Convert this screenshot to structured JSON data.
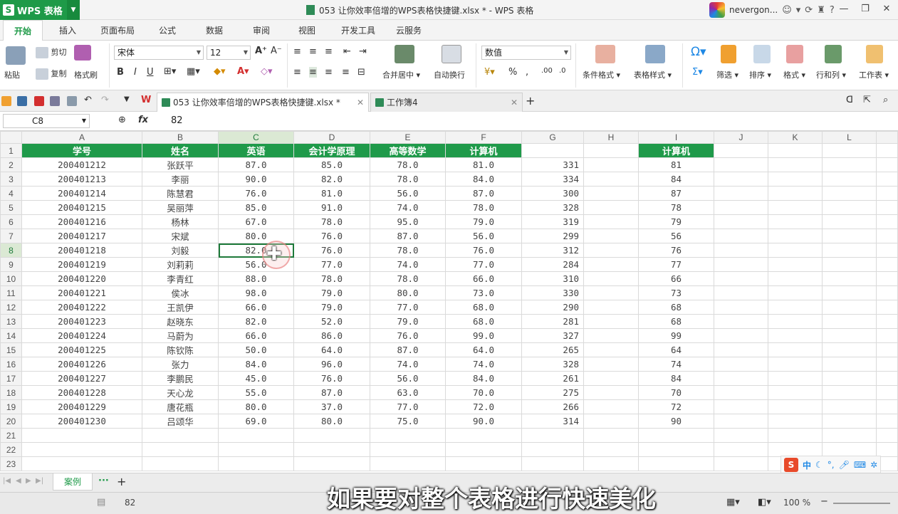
{
  "app": {
    "name": "WPS 表格",
    "doc_title": "053 让你效率倍增的WPS表格快捷键.xlsx * - WPS 表格",
    "user": "nevergon...",
    "logo_letter": "S"
  },
  "ribbon_tabs": [
    "开始",
    "插入",
    "页面布局",
    "公式",
    "数据",
    "审阅",
    "视图",
    "开发工具",
    "云服务"
  ],
  "ribbon": {
    "paste": "粘贴",
    "cut": "剪切",
    "copy": "复制",
    "format_painter": "格式刷",
    "font_name": "宋体",
    "font_size": "12",
    "bold": "B",
    "italic": "I",
    "underline": "U",
    "merge_center": "合并居中",
    "wrap_text": "自动换行",
    "number_format": "数值",
    "conditional_format": "条件格式",
    "table_style": "表格样式",
    "sum": "Σ",
    "filter": "筛选",
    "sort": "排序",
    "format": "格式",
    "row_col": "行和列",
    "worksheet": "工作表",
    "percent": "%",
    "comma": ","
  },
  "doc_tabs": [
    {
      "label": "053 让你效率倍增的WPS表格快捷键.xlsx *"
    },
    {
      "label": "工作簿4"
    }
  ],
  "formula_bar": {
    "name_box": "C8",
    "fx": "fx",
    "value": "82"
  },
  "columns": [
    "A",
    "B",
    "C",
    "D",
    "E",
    "F",
    "G",
    "H",
    "I",
    "J",
    "K",
    "L"
  ],
  "sheet": {
    "headers": [
      "学号",
      "姓名",
      "英语",
      "会计学原理",
      "高等数学",
      "计算机"
    ],
    "side_header": "计算机",
    "rows": [
      [
        "200401212",
        "张跃平",
        "87.0",
        "85.0",
        "78.0",
        "81.0",
        "331",
        "81"
      ],
      [
        "200401213",
        "李丽",
        "90.0",
        "82.0",
        "78.0",
        "84.0",
        "334",
        "84"
      ],
      [
        "200401214",
        "陈慧君",
        "76.0",
        "81.0",
        "56.0",
        "87.0",
        "300",
        "87"
      ],
      [
        "200401215",
        "吴丽萍",
        "85.0",
        "91.0",
        "74.0",
        "78.0",
        "328",
        "78"
      ],
      [
        "200401216",
        "杨林",
        "67.0",
        "78.0",
        "95.0",
        "79.0",
        "319",
        "79"
      ],
      [
        "200401217",
        "宋斌",
        "80.0",
        "76.0",
        "87.0",
        "56.0",
        "299",
        "56"
      ],
      [
        "200401218",
        "刘毅",
        "82.0",
        "76.0",
        "78.0",
        "76.0",
        "312",
        "76"
      ],
      [
        "200401219",
        "刘莉莉",
        "56.0",
        "77.0",
        "74.0",
        "77.0",
        "284",
        "77"
      ],
      [
        "200401220",
        "李青红",
        "88.0",
        "78.0",
        "78.0",
        "66.0",
        "310",
        "66"
      ],
      [
        "200401221",
        "侯冰",
        "98.0",
        "79.0",
        "80.0",
        "73.0",
        "330",
        "73"
      ],
      [
        "200401222",
        "王凯伊",
        "66.0",
        "79.0",
        "77.0",
        "68.0",
        "290",
        "68"
      ],
      [
        "200401223",
        "赵晓东",
        "82.0",
        "52.0",
        "79.0",
        "68.0",
        "281",
        "68"
      ],
      [
        "200401224",
        "马蔚为",
        "66.0",
        "86.0",
        "76.0",
        "99.0",
        "327",
        "99"
      ],
      [
        "200401225",
        "陈钦陈",
        "50.0",
        "64.0",
        "87.0",
        "64.0",
        "265",
        "64"
      ],
      [
        "200401226",
        "张力",
        "84.0",
        "96.0",
        "74.0",
        "74.0",
        "328",
        "74"
      ],
      [
        "200401227",
        "李鹏民",
        "45.0",
        "76.0",
        "56.0",
        "84.0",
        "261",
        "84"
      ],
      [
        "200401228",
        "天心龙",
        "55.0",
        "87.0",
        "63.0",
        "70.0",
        "275",
        "70"
      ],
      [
        "200401229",
        "唐花瓶",
        "80.0",
        "37.0",
        "77.0",
        "72.0",
        "266",
        "72"
      ],
      [
        "200401230",
        "吕颂华",
        "69.0",
        "80.0",
        "75.0",
        "90.0",
        "314",
        "90"
      ]
    ],
    "total_rows": 23,
    "active_cell": "C8"
  },
  "sheet_tabs": [
    "案例"
  ],
  "status": {
    "value": "82",
    "zoom": "100 %"
  },
  "ime": {
    "lang": "中"
  },
  "subtitle": "如果要对整个表格进行快速美化",
  "colors": {
    "accent": "#1e9a48",
    "header_fill": "#1f9a4a"
  }
}
